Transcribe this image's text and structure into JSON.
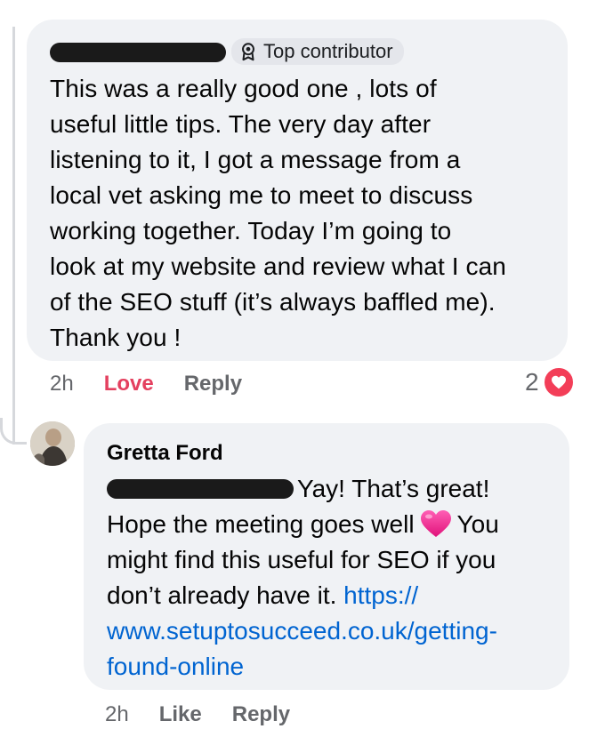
{
  "thread": {
    "comment": {
      "author_redacted": true,
      "badge": {
        "icon": "top-contributor-icon",
        "label": "Top contributor"
      },
      "text": "This was a really good one , lots of\nuseful little tips. The very day after\nlistening to it, I got a message from a\nlocal vet asking me to meet to discuss\nworking together.  Today I’m going to\nlook at my website and review what I can\nof the SEO stuff (it’s always baffled me).\nThank you !",
      "actions": {
        "time": "2h",
        "love": "Love",
        "reply": "Reply"
      },
      "reaction": {
        "count": "2",
        "icon": "heart-reaction-icon",
        "color": "#f33e58"
      }
    },
    "reply": {
      "author": "Gretta Ford",
      "mention_redacted": true,
      "text_part1": "Yay! That’s great!",
      "text_part2": "Hope the meeting goes well",
      "emoji": "pink-heart-emoji",
      "text_part3": "You might find this useful for SEO if you don’t already have it.",
      "link_line1": "https://",
      "link_line2": "www.setuptosucceed.co.uk/getting-",
      "link_line3": "found-online",
      "actions": {
        "time": "2h",
        "like": "Like",
        "reply": "Reply"
      }
    }
  },
  "colors": {
    "bubble_bg": "#f0f2f5",
    "love": "#e4405f",
    "link": "#0064d1",
    "meta_text": "#65676b"
  }
}
